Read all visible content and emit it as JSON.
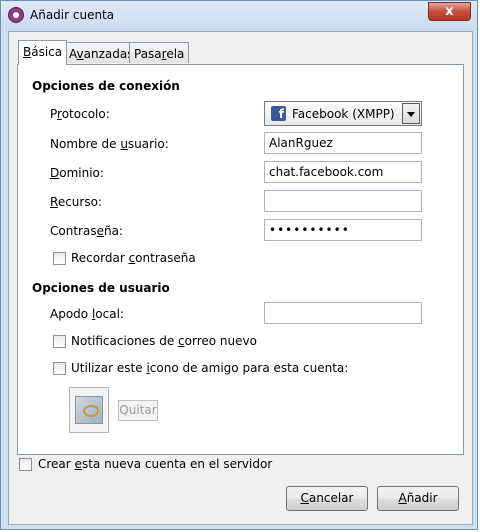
{
  "window": {
    "title": "Añadir cuenta",
    "close_glyph": "x",
    "icon": "pidgin-app-icon"
  },
  "tabs": [
    {
      "pre": "",
      "ul": "B",
      "post": "ásica"
    },
    {
      "pre": "A",
      "ul": "v",
      "post": "anzadas"
    },
    {
      "pre": "Pasa",
      "ul": "r",
      "post": "ela"
    }
  ],
  "connection": {
    "heading": "Opciones de conexión",
    "protocol": {
      "pre": "P",
      "ul": "r",
      "post": "otocolo:",
      "value": "Facebook (XMPP)",
      "icon_glyph": "f"
    },
    "username": {
      "pre": "Nombre de ",
      "ul": "u",
      "post": "suario:",
      "value": "AlanRguez"
    },
    "domain": {
      "pre": "",
      "ul": "D",
      "post": "ominio:",
      "value": "chat.facebook.com"
    },
    "resource": {
      "pre": "",
      "ul": "R",
      "post": "ecurso:",
      "value": ""
    },
    "password": {
      "pre": "Contras",
      "ul": "e",
      "post": "ña:",
      "value": "••••••••••"
    },
    "remember": {
      "pre": "Recordar ",
      "ul": "c",
      "post": "ontraseña"
    }
  },
  "user_options": {
    "heading": "Opciones de usuario",
    "alias": {
      "pre": "Apodo ",
      "ul": "l",
      "post": "ocal:",
      "value": ""
    },
    "mail_notify": {
      "pre": "Notificaciones de ",
      "ul": "c",
      "post": "orreo nuevo"
    },
    "buddy_icon": {
      "pre": "Utilizar este ",
      "ul": "i",
      "post": "cono de amigo para esta cuenta:"
    },
    "remove_label": "Quitar"
  },
  "create_on_server": {
    "pre": "Crear ",
    "ul": "e",
    "post": "sta nueva cuenta en el servidor"
  },
  "buttons": {
    "cancel": {
      "pre": "",
      "ul": "C",
      "post": "ancelar"
    },
    "add": {
      "pre": "",
      "ul": "A",
      "post": "ñadir"
    }
  }
}
